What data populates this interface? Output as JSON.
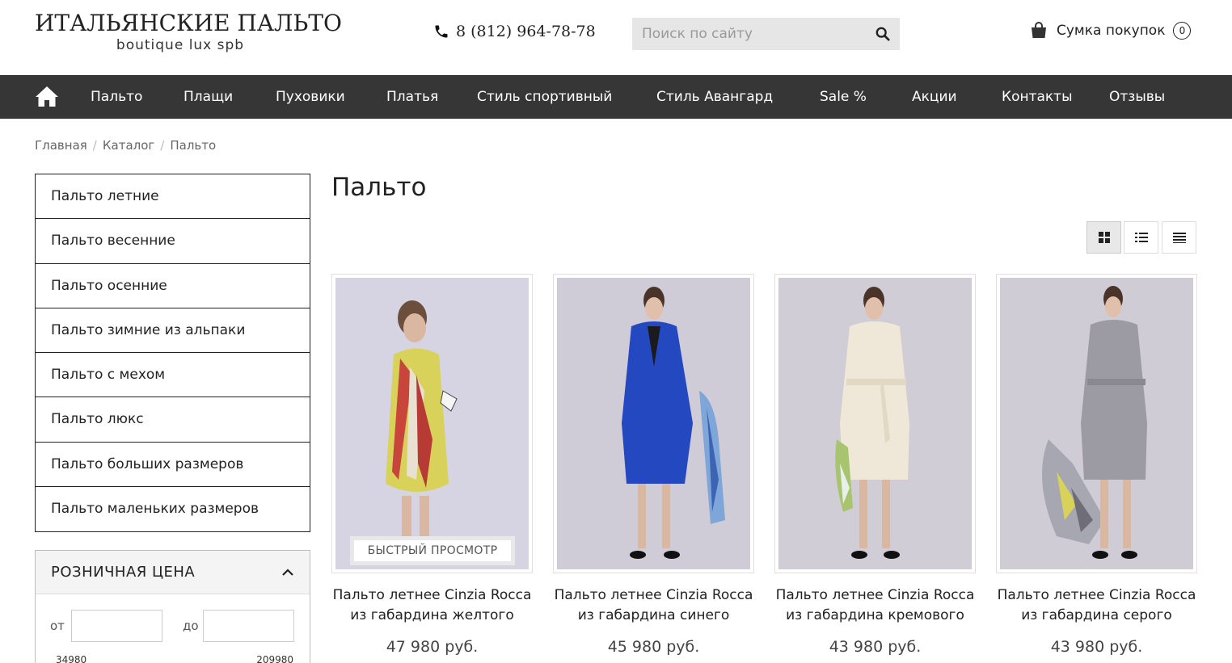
{
  "header": {
    "logo_title": "ИТАЛЬЯНСКИЕ ПАЛЬТО",
    "logo_subtitle": "boutique lux spb",
    "phone": "8 (812) 964-78-78",
    "search_placeholder": "Поиск по сайту",
    "cart_label": "Сумка покупок",
    "cart_count": "0"
  },
  "nav": {
    "items": [
      "Пальто",
      "Плащи",
      "Пуховики",
      "Платья",
      "Стиль спортивный",
      "Стиль Авангард",
      "Sale %",
      "Акции",
      "Контакты",
      "Отзывы"
    ]
  },
  "breadcrumb": [
    "Главная",
    "Каталог",
    "Пальто"
  ],
  "sidebar": {
    "categories": [
      "Пальто летние",
      "Пальто весенние",
      "Пальто осенние",
      "Пальто зимние из альпаки",
      "Пальто с мехом",
      "Пальто люкс",
      "Пальто больших размеров",
      "Пальто маленьких размеров"
    ],
    "price_filter": {
      "title": "РОЗНИЧНАЯ ЦЕНА",
      "from_label": "от",
      "to_label": "до",
      "min": "34980",
      "max": "209980"
    }
  },
  "main": {
    "title": "Пальто",
    "quick_view": "БЫСТРЫЙ ПРОСМОТР",
    "products": [
      {
        "name": "Пальто летнее Cinzia Rocca из габардина желтого",
        "price": "47 980 руб.",
        "coat_color": "#d9d25a"
      },
      {
        "name": "Пальто летнее Cinzia Rocca из габардина синего",
        "price": "45 980 руб.",
        "coat_color": "#2348c0"
      },
      {
        "name": "Пальто летнее Cinzia Rocca из габардина кремового",
        "price": "43 980 руб.",
        "coat_color": "#efe8d8"
      },
      {
        "name": "Пальто летнее Cinzia Rocca из габардина серого",
        "price": "43 980 руб.",
        "coat_color": "#9c9aa2"
      }
    ]
  },
  "colors": {
    "nav_bg": "#363636",
    "photo_bg": "#cfccd8"
  }
}
